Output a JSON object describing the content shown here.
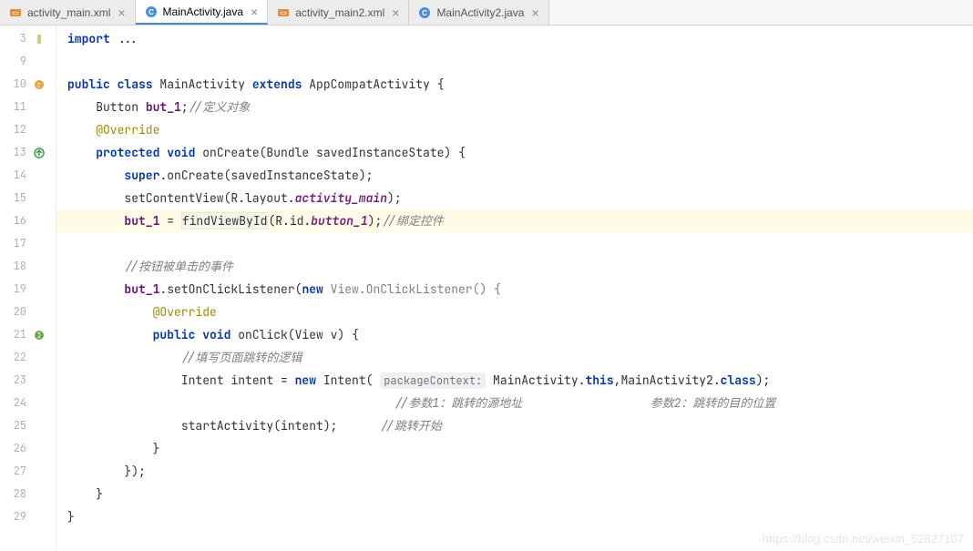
{
  "tabs": [
    {
      "label": "activity_main.xml",
      "icon": "xml",
      "active": false
    },
    {
      "label": "MainActivity.java",
      "icon": "java-class",
      "active": true
    },
    {
      "label": "activity_main2.xml",
      "icon": "xml",
      "active": false
    },
    {
      "label": "MainActivity2.java",
      "icon": "java-class",
      "active": false
    }
  ],
  "gutter": {
    "start": 3,
    "end": 29,
    "highlighted_line": 16,
    "markers": {
      "3": "edited",
      "10": "class-icon",
      "13": "override-up",
      "21": "override-impl"
    }
  },
  "code": {
    "l3": {
      "indent": "",
      "parts": [
        {
          "t": "import ",
          "c": "kw"
        },
        {
          "t": "...",
          "c": ""
        }
      ]
    },
    "l9": {
      "indent": "",
      "parts": []
    },
    "l10": {
      "indent": "",
      "parts": [
        {
          "t": "public class ",
          "c": "kw"
        },
        {
          "t": "MainActivity ",
          "c": ""
        },
        {
          "t": "extends ",
          "c": "kw"
        },
        {
          "t": "AppCompatActivity {",
          "c": ""
        }
      ]
    },
    "l11": {
      "indent": "    ",
      "parts": [
        {
          "t": "Button ",
          "c": ""
        },
        {
          "t": "but_1",
          "c": "field"
        },
        {
          "t": ";",
          "c": ""
        },
        {
          "t": "//定义对象",
          "c": "comment"
        }
      ]
    },
    "l12": {
      "indent": "    ",
      "parts": [
        {
          "t": "@Override",
          "c": "annot"
        }
      ]
    },
    "l13": {
      "indent": "    ",
      "parts": [
        {
          "t": "protected void ",
          "c": "kw"
        },
        {
          "t": "onCreate(Bundle savedInstanceState) {",
          "c": ""
        }
      ]
    },
    "l14": {
      "indent": "        ",
      "parts": [
        {
          "t": "super",
          "c": "kw"
        },
        {
          "t": ".onCreate(savedInstanceState);",
          "c": ""
        }
      ]
    },
    "l15": {
      "indent": "        ",
      "parts": [
        {
          "t": "setContentView(R.layout.",
          "c": ""
        },
        {
          "t": "activity_main",
          "c": "str-ital"
        },
        {
          "t": ");",
          "c": ""
        }
      ]
    },
    "l16": {
      "indent": "        ",
      "parts": [
        {
          "t": "but_1",
          "c": "field"
        },
        {
          "t": " = ",
          "c": ""
        },
        {
          "t": "findViewById",
          "c": "caret-box"
        },
        {
          "t": "(R.id.",
          "c": ""
        },
        {
          "t": "button_1",
          "c": "str-ital"
        },
        {
          "t": ");",
          "c": ""
        },
        {
          "t": "//绑定控件",
          "c": "comment"
        }
      ]
    },
    "l17": {
      "indent": "",
      "parts": []
    },
    "l18": {
      "indent": "        ",
      "parts": [
        {
          "t": "//按钮被单击的事件",
          "c": "comment"
        }
      ]
    },
    "l19": {
      "indent": "        ",
      "parts": [
        {
          "t": "but_1",
          "c": "field"
        },
        {
          "t": ".setOnClickListener(",
          "c": ""
        },
        {
          "t": "new ",
          "c": "kw"
        },
        {
          "t": "View.OnClickListener() {",
          "c": "comment0",
          "style": "color:#808080"
        }
      ]
    },
    "l20": {
      "indent": "            ",
      "parts": [
        {
          "t": "@Override",
          "c": "annot"
        }
      ]
    },
    "l21": {
      "indent": "            ",
      "parts": [
        {
          "t": "public void ",
          "c": "kw"
        },
        {
          "t": "onClick(View v) {",
          "c": ""
        }
      ]
    },
    "l22": {
      "indent": "                ",
      "parts": [
        {
          "t": "//填写页面跳转的逻辑",
          "c": "comment"
        }
      ]
    },
    "l23": {
      "indent": "                ",
      "parts": [
        {
          "t": "Intent intent = ",
          "c": ""
        },
        {
          "t": "new ",
          "c": "kw"
        },
        {
          "t": "Intent( ",
          "c": ""
        },
        {
          "t": "packageContext:",
          "c": "param-hint"
        },
        {
          "t": " MainActivity.",
          "c": ""
        },
        {
          "t": "this",
          "c": "kw"
        },
        {
          "t": ",MainActivity2.",
          "c": ""
        },
        {
          "t": "class",
          "c": "kw"
        },
        {
          "t": ");",
          "c": ""
        }
      ]
    },
    "l24": {
      "indent": "                                              ",
      "parts": [
        {
          "t": "//参数1：跳转的源地址                  参数2：跳转的目的位置",
          "c": "comment"
        }
      ]
    },
    "l25": {
      "indent": "                ",
      "parts": [
        {
          "t": "startActivity(intent);      ",
          "c": ""
        },
        {
          "t": "//跳转开始",
          "c": "comment"
        }
      ]
    },
    "l26": {
      "indent": "            ",
      "parts": [
        {
          "t": "}",
          "c": ""
        }
      ]
    },
    "l27": {
      "indent": "        ",
      "parts": [
        {
          "t": "});",
          "c": ""
        }
      ]
    },
    "l28": {
      "indent": "    ",
      "parts": [
        {
          "t": "}",
          "c": ""
        }
      ]
    },
    "l29": {
      "indent": "",
      "parts": [
        {
          "t": "}",
          "c": ""
        }
      ]
    }
  },
  "watermark": "https://blog.csdn.net/weixin_52827107"
}
